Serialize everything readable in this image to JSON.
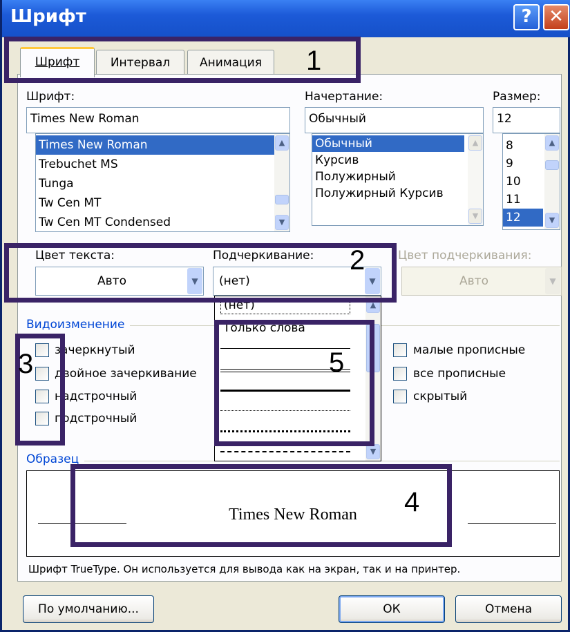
{
  "window": {
    "title": "Шрифт"
  },
  "tabs": [
    "Шрифт",
    "Интервал",
    "Анимация"
  ],
  "font": {
    "label": "Шрифт:",
    "value": "Times New Roman",
    "items": [
      "Times New Roman",
      "Trebuchet MS",
      "Tunga",
      "Tw Cen MT",
      "Tw Cen MT Condensed"
    ]
  },
  "style": {
    "label": "Начертание:",
    "value": "Обычный",
    "items": [
      "Обычный",
      "Курсив",
      "Полужирный",
      "Полужирный Курсив"
    ]
  },
  "size": {
    "label": "Размер:",
    "value": "12",
    "items": [
      "8",
      "9",
      "10",
      "11",
      "12"
    ]
  },
  "color": {
    "label": "Цвет текста:",
    "value": "Авто"
  },
  "underline": {
    "label": "Подчеркивание:",
    "value": "(нет)",
    "options": [
      "(нет)",
      "Только слова"
    ]
  },
  "underline_color": {
    "label": "Цвет подчеркивания:",
    "value": "Авто"
  },
  "effects": {
    "title": "Видоизменение",
    "left": [
      "зачеркнутый",
      "двойное зачеркивание",
      "надстрочный",
      "подстрочный"
    ],
    "right": [
      "малые прописные",
      "все прописные",
      "скрытый"
    ]
  },
  "preview": {
    "title": "Образец",
    "text": "Times New Roman",
    "note": "Шрифт TrueType. Он используется для вывода как на экран, так и на принтер."
  },
  "buttons": {
    "default": "По умолчанию...",
    "ok": "ОК",
    "cancel": "Отмена"
  },
  "annotations": [
    "1",
    "2",
    "3",
    "4",
    "5"
  ],
  "colors": {
    "annotation": "#3a2366",
    "selection": "#316ac5",
    "titlebar": "#1c5ad8"
  }
}
